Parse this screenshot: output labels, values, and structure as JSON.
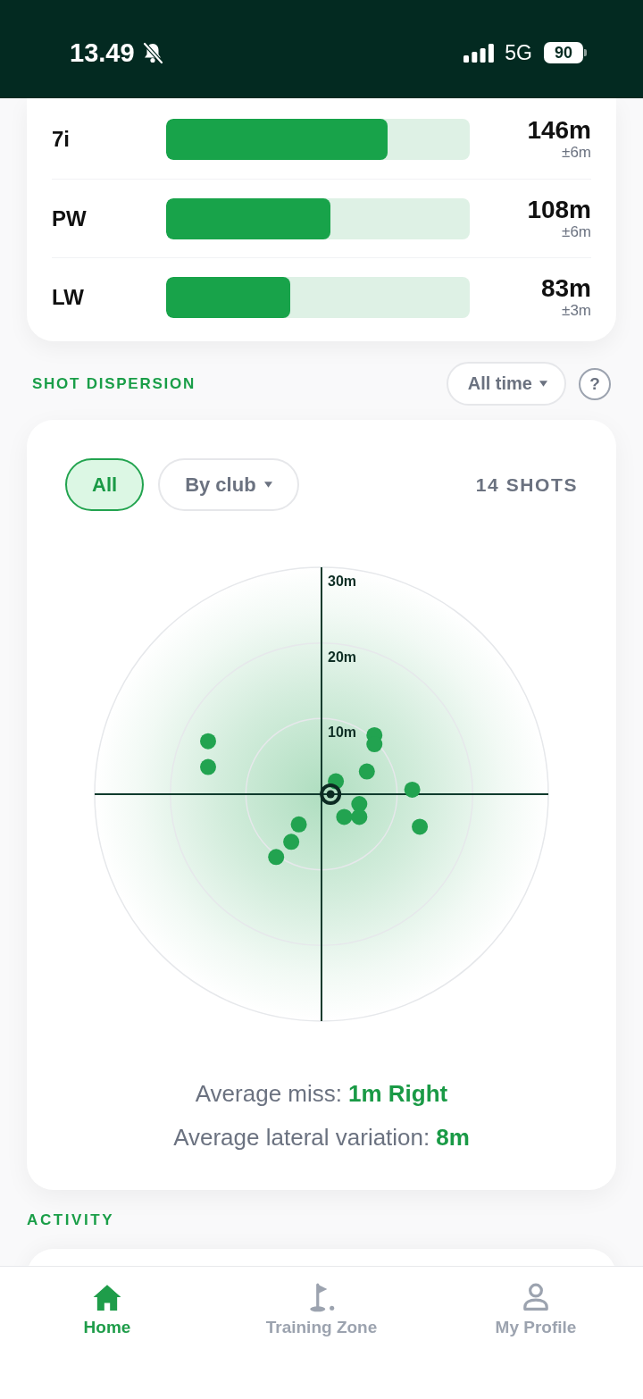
{
  "status_bar": {
    "time": "13.49",
    "silent": true,
    "network": "5G",
    "battery": "90"
  },
  "club_distances": [
    {
      "club": "7i",
      "level": 0.73,
      "distance": "146m",
      "spread": "±6m"
    },
    {
      "club": "PW",
      "level": 0.54,
      "distance": "108m",
      "spread": "±6m"
    },
    {
      "club": "LW",
      "level": 0.41,
      "distance": "83m",
      "spread": "±3m"
    }
  ],
  "shot_dispersion": {
    "title": "SHOT DISPERSION",
    "period": {
      "label": "All time",
      "dropdown": true
    },
    "help": "?",
    "filters": [
      {
        "label": "All",
        "selected": true,
        "dropdown": false
      },
      {
        "label": "By club",
        "selected": false,
        "dropdown": true
      }
    ],
    "shot_count": "14 SHOTS",
    "plot": {
      "ring_labels": [
        "30m",
        "20m",
        "10m"
      ]
    },
    "summary": [
      {
        "label": "Average miss:",
        "value": "1m Right"
      },
      {
        "label": "Average lateral variation:",
        "value": "8m"
      }
    ]
  },
  "activity": {
    "title": "ACTIVITY"
  },
  "nav": [
    {
      "label": "Home",
      "kind": "home",
      "selected": true
    },
    {
      "label": "Training Zone",
      "kind": "flag",
      "selected": false
    },
    {
      "label": "My Profile",
      "kind": "person",
      "selected": false
    }
  ]
}
